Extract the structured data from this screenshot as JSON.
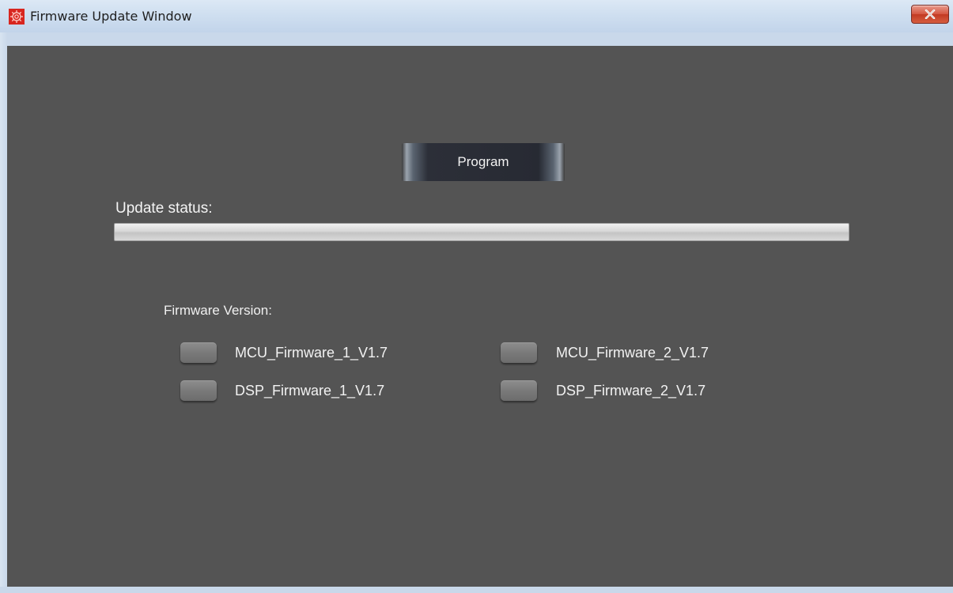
{
  "window": {
    "title": "Firmware Update Window",
    "icon": "app-logo-icon",
    "close_icon": "close-icon"
  },
  "main": {
    "program_button_label": "Program",
    "status_label": "Update status:",
    "progress_fraction": 0,
    "firmware_heading": "Firmware Version:",
    "firmware_items": [
      {
        "label": "MCU_Firmware_1_V1.7"
      },
      {
        "label": "MCU_Firmware_2_V1.7"
      },
      {
        "label": "DSP_Firmware_1_V1.7"
      },
      {
        "label": "DSP_Firmware_2_V1.7"
      }
    ]
  },
  "colors": {
    "client_background": "#545454",
    "close_button": "#c9432c",
    "indicator_off": "#7a7a7a"
  }
}
